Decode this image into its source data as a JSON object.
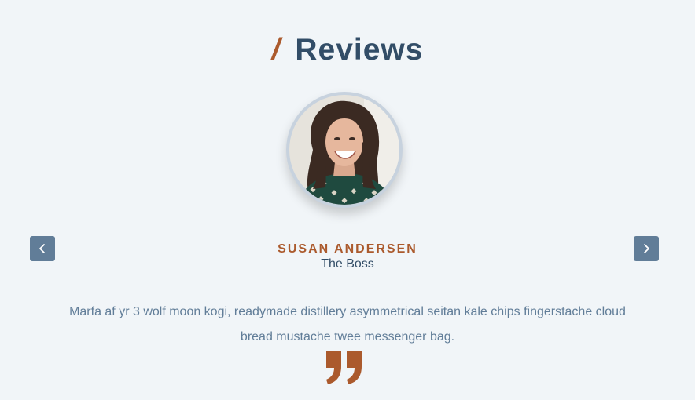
{
  "section": {
    "title_slash": "/",
    "title": "Reviews"
  },
  "review": {
    "name": "SUSAN ANDERSEN",
    "job": "The Boss",
    "text": "Marfa af yr 3 wolf moon kogi, readymade distillery asymmetrical seitan kale chips fingerstache cloud bread mustache twee messenger bag."
  },
  "icons": {
    "prev": "chevron-left-icon",
    "next": "chevron-right-icon",
    "quote": "quote-right-icon"
  },
  "colors": {
    "background": "#f1f5f8",
    "title": "#324d67",
    "accent": "#ab5a2d",
    "button": "#617d98",
    "body_text": "#617d98"
  }
}
